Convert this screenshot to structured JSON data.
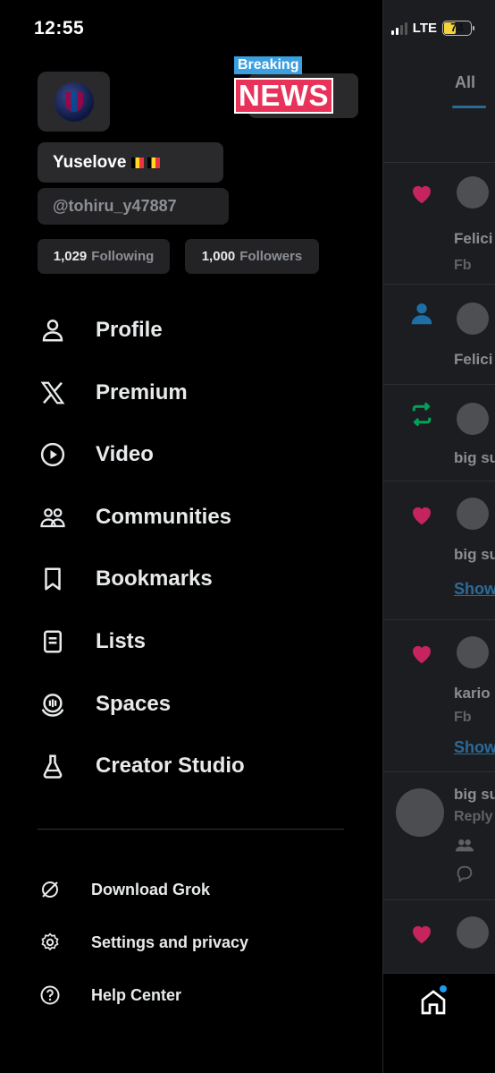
{
  "status_bar": {
    "time": "12:55",
    "network": "LTE",
    "battery": "74"
  },
  "profile": {
    "display_name": "Yuselove",
    "handle": "@tohiru_y47887",
    "following_count": "1,029",
    "following_label": "Following",
    "followers_count": "1,000",
    "followers_label": "Followers"
  },
  "badge": {
    "top": "Breaking",
    "main": "NEWS"
  },
  "menu": [
    {
      "label": "Profile",
      "icon": "person-icon"
    },
    {
      "label": "Premium",
      "icon": "x-logo-icon"
    },
    {
      "label": "Video",
      "icon": "play-circle-icon"
    },
    {
      "label": "Communities",
      "icon": "communities-icon"
    },
    {
      "label": "Bookmarks",
      "icon": "bookmark-icon"
    },
    {
      "label": "Lists",
      "icon": "list-icon"
    },
    {
      "label": "Spaces",
      "icon": "spaces-icon"
    },
    {
      "label": "Creator Studio",
      "icon": "flask-icon"
    }
  ],
  "secondary_menu": [
    {
      "label": "Download Grok",
      "icon": "grok-icon"
    },
    {
      "label": "Settings and privacy",
      "icon": "gear-icon"
    },
    {
      "label": "Help Center",
      "icon": "help-icon"
    }
  ],
  "feed": {
    "tab_all": "All",
    "items": [
      {
        "text": "Felici",
        "sub": "Fb"
      },
      {
        "text": "Felici"
      },
      {
        "text": "big su"
      },
      {
        "text": "big su",
        "link": "Show"
      },
      {
        "text": "kario",
        "sub": "Fb",
        "link": "Show"
      },
      {
        "text": "big su",
        "sub": "Reply"
      }
    ]
  },
  "colors": {
    "like": "#c5245d",
    "repost": "#00a35a",
    "follow": "#1d9bf0",
    "background": "#000000"
  }
}
